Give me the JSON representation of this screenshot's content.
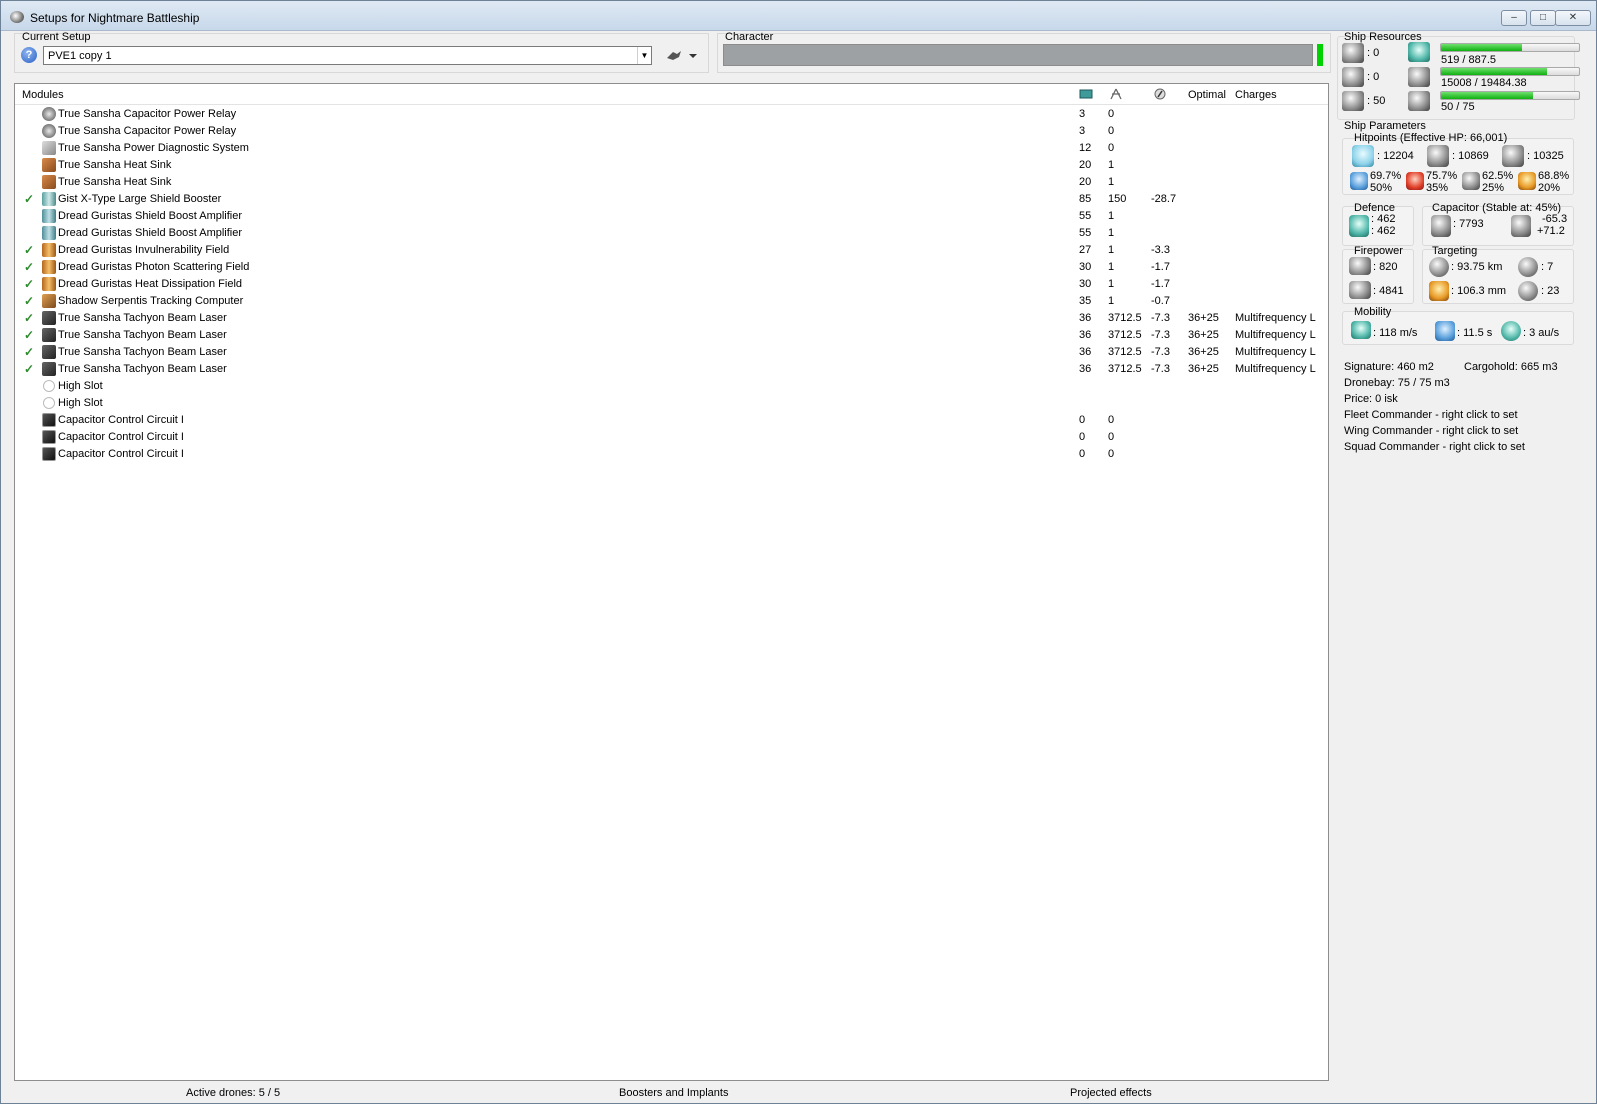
{
  "window": {
    "title": "Setups for Nightmare Battleship",
    "minimize_glyph": "–",
    "maximize_glyph": "□",
    "close_glyph": "✕"
  },
  "setup": {
    "label": "Current Setup",
    "selected": "PVE1 copy 1",
    "help_glyph": "?"
  },
  "character": {
    "label": "Character",
    "value": ""
  },
  "modules": {
    "columns": {
      "name": "Modules",
      "optimal": "Optimal",
      "charges": "Charges"
    },
    "header_icons": [
      "cpu-icon",
      "powergrid-icon",
      "capacitor-icon"
    ],
    "rows": [
      {
        "checked": false,
        "icon": "capacitor-relay-icon",
        "name": "True Sansha Capacitor Power Relay",
        "cpu": "3",
        "pg": "0",
        "cap": "",
        "optimal": "",
        "charges": ""
      },
      {
        "checked": false,
        "icon": "capacitor-relay-icon",
        "name": "True Sansha Capacitor Power Relay",
        "cpu": "3",
        "pg": "0",
        "cap": "",
        "optimal": "",
        "charges": ""
      },
      {
        "checked": false,
        "icon": "power-diagnostic-icon",
        "name": "True Sansha Power Diagnostic System",
        "cpu": "12",
        "pg": "0",
        "cap": "",
        "optimal": "",
        "charges": ""
      },
      {
        "checked": false,
        "icon": "heat-sink-icon",
        "name": "True Sansha Heat Sink",
        "cpu": "20",
        "pg": "1",
        "cap": "",
        "optimal": "",
        "charges": ""
      },
      {
        "checked": false,
        "icon": "heat-sink-icon",
        "name": "True Sansha Heat Sink",
        "cpu": "20",
        "pg": "1",
        "cap": "",
        "optimal": "",
        "charges": ""
      },
      {
        "checked": true,
        "icon": "shield-booster-icon",
        "name": "Gist X-Type Large Shield Booster",
        "cpu": "85",
        "pg": "150",
        "cap": "-28.7",
        "optimal": "",
        "charges": ""
      },
      {
        "checked": false,
        "icon": "shield-amplifier-icon",
        "name": "Dread Guristas Shield Boost Amplifier",
        "cpu": "55",
        "pg": "1",
        "cap": "",
        "optimal": "",
        "charges": ""
      },
      {
        "checked": false,
        "icon": "shield-amplifier-icon",
        "name": "Dread Guristas Shield Boost Amplifier",
        "cpu": "55",
        "pg": "1",
        "cap": "",
        "optimal": "",
        "charges": ""
      },
      {
        "checked": true,
        "icon": "hardener-icon",
        "name": "Dread Guristas Invulnerability Field",
        "cpu": "27",
        "pg": "1",
        "cap": "-3.3",
        "optimal": "",
        "charges": ""
      },
      {
        "checked": true,
        "icon": "hardener-icon",
        "name": "Dread Guristas Photon Scattering Field",
        "cpu": "30",
        "pg": "1",
        "cap": "-1.7",
        "optimal": "",
        "charges": ""
      },
      {
        "checked": true,
        "icon": "hardener-icon",
        "name": "Dread Guristas Heat Dissipation Field",
        "cpu": "30",
        "pg": "1",
        "cap": "-1.7",
        "optimal": "",
        "charges": ""
      },
      {
        "checked": true,
        "icon": "tracking-computer-icon",
        "name": "Shadow Serpentis Tracking Computer",
        "cpu": "35",
        "pg": "1",
        "cap": "-0.7",
        "optimal": "",
        "charges": ""
      },
      {
        "checked": true,
        "icon": "beam-laser-icon",
        "name": "True Sansha Tachyon Beam Laser",
        "cpu": "36",
        "pg": "3712.5",
        "cap": "-7.3",
        "optimal": "36+25",
        "charges": "Multifrequency L"
      },
      {
        "checked": true,
        "icon": "beam-laser-icon",
        "name": "True Sansha Tachyon Beam Laser",
        "cpu": "36",
        "pg": "3712.5",
        "cap": "-7.3",
        "optimal": "36+25",
        "charges": "Multifrequency L"
      },
      {
        "checked": true,
        "icon": "beam-laser-icon",
        "name": "True Sansha Tachyon Beam Laser",
        "cpu": "36",
        "pg": "3712.5",
        "cap": "-7.3",
        "optimal": "36+25",
        "charges": "Multifrequency L"
      },
      {
        "checked": true,
        "icon": "beam-laser-icon",
        "name": "True Sansha Tachyon Beam Laser",
        "cpu": "36",
        "pg": "3712.5",
        "cap": "-7.3",
        "optimal": "36+25",
        "charges": "Multifrequency L"
      },
      {
        "checked": false,
        "icon": "high-slot-icon",
        "name": "High Slot",
        "cpu": "",
        "pg": "",
        "cap": "",
        "optimal": "",
        "charges": ""
      },
      {
        "checked": false,
        "icon": "high-slot-icon",
        "name": "High Slot",
        "cpu": "",
        "pg": "",
        "cap": "",
        "optimal": "",
        "charges": ""
      },
      {
        "checked": false,
        "icon": "capacitor-control-circuit-icon",
        "name": "Capacitor Control Circuit I",
        "cpu": "0",
        "pg": "0",
        "cap": "",
        "optimal": "",
        "charges": ""
      },
      {
        "checked": false,
        "icon": "capacitor-control-circuit-icon",
        "name": "Capacitor Control Circuit I",
        "cpu": "0",
        "pg": "0",
        "cap": "",
        "optimal": "",
        "charges": ""
      },
      {
        "checked": false,
        "icon": "capacitor-control-circuit-icon",
        "name": "Capacitor Control Circuit I",
        "cpu": "0",
        "pg": "0",
        "cap": "",
        "optimal": "",
        "charges": ""
      }
    ]
  },
  "status_bar": {
    "drones": "Active drones: 5 / 5",
    "boosters": "Boosters and Implants",
    "projected": "Projected effects"
  },
  "resources": {
    "label": "Ship Resources",
    "turret_hardpoints": ": 0",
    "launcher_hardpoints": ": 0",
    "calibration": ": 50",
    "cpu": {
      "text": "519 / 887.5",
      "fraction": 0.585
    },
    "powergrid": {
      "text": "15008 / 19484.38",
      "fraction": 0.77
    },
    "drone_bandwidth": {
      "text": "50 / 75",
      "fraction": 0.667
    }
  },
  "parameters": {
    "label": "Ship Parameters",
    "hitpoints": {
      "label": "Hitpoints (Effective HP: 66,001)",
      "shield": ": 12204",
      "armor": ": 10869",
      "structure": ": 10325",
      "em_a": "69.7%",
      "em_b": "50%",
      "thermal_a": "75.7%",
      "thermal_b": "35%",
      "kinetic_a": "62.5%",
      "kinetic_b": "25%",
      "explosive_a": "68.8%",
      "explosive_b": "20%"
    },
    "defence": {
      "label": "Defence",
      "a": ": 462",
      "b": ": 462"
    },
    "capacitor": {
      "label": "Capacitor (Stable at: 45%)",
      "capacity": ": 7793",
      "a": "-65.3",
      "b": "+71.2"
    },
    "firepower": {
      "label": "Firepower",
      "volley": ": 820",
      "dps": ": 4841"
    },
    "targeting": {
      "label": "Targeting",
      "range": ": 93.75 km",
      "targets": ": 7",
      "resolution": ": 106.3 mm",
      "sensor": ": 23"
    },
    "mobility": {
      "label": "Mobility",
      "speed": ": 118 m/s",
      "align": ": 11.5 s",
      "warp": ": 3 au/s"
    },
    "signature": "Signature: 460 m2",
    "cargohold": "Cargohold: 665 m3",
    "dronebay": "Dronebay: 75 / 75 m3",
    "price": "Price: 0 isk",
    "fleet_commander": "Fleet Commander - right click to set",
    "wing_commander": "Wing Commander - right click to set",
    "squad_commander": "Squad Commander - right click to set"
  }
}
